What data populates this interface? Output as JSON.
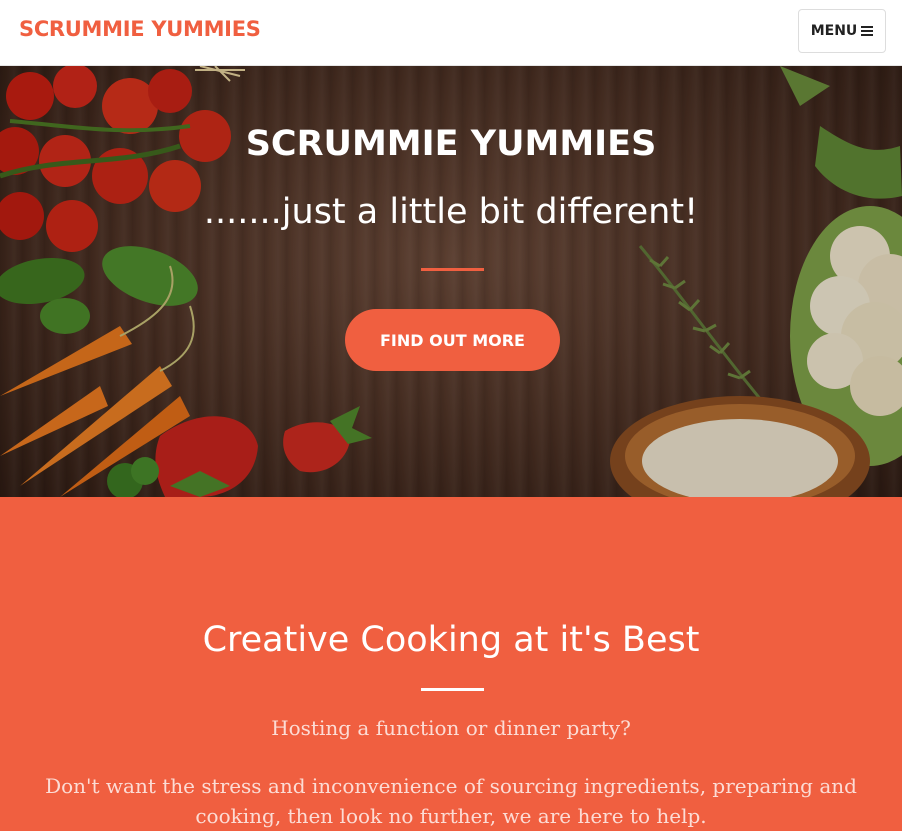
{
  "navbar": {
    "brand": "SCRUMMIE YUMMIES",
    "menu_label": "MENU",
    "menu_icon": "bars-icon"
  },
  "hero": {
    "title": "SCRUMMIE YUMMIES",
    "subtitle": ".......just a little bit different!",
    "cta_label": "FIND OUT MORE"
  },
  "about": {
    "title": "Creative Cooking at it's Best",
    "lead": "Hosting a function or dinner party?",
    "body": "Don't want the stress and inconvenience of sourcing ingredients, preparing and cooking, then look no further, we are here to help."
  },
  "colors": {
    "accent": "#f05f40",
    "nav_bg": "#ffffff",
    "hero_wood": "#4a3024"
  }
}
